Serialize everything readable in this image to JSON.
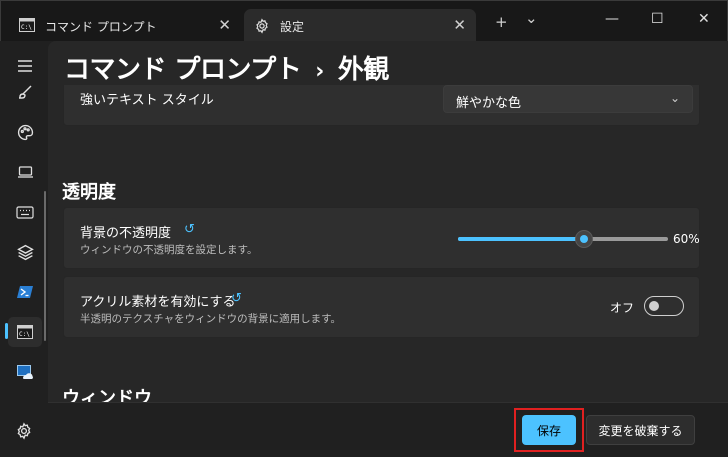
{
  "tabs": [
    {
      "label": "コマンド プロンプト",
      "icon": "cmd-icon",
      "close": "✕"
    },
    {
      "label": "設定",
      "icon": "gear-icon",
      "close": "✕"
    }
  ],
  "titlebar": {
    "new_tab": "+",
    "dropdown": "⌄",
    "minimize": "—",
    "maximize": "☐",
    "close": "✕"
  },
  "breadcrumb": {
    "parent": "コマンド プロンプト",
    "separator": "›",
    "current": "外観"
  },
  "text_style": {
    "label": "強いテキスト スタイル",
    "value": "鮮やかな色",
    "chevron": "⌄"
  },
  "transparency": {
    "section_title": "透明度",
    "opacity": {
      "title": "背景の不透明度",
      "description": "ウィンドウの不透明度を設定します。",
      "value_text": "60%",
      "value": 0.6
    },
    "acrylic": {
      "title": "アクリル素材を有効にする",
      "description": "半透明のテクスチャをウィンドウの背景に適用します。",
      "state_text": "オフ",
      "on": false
    }
  },
  "next_section": "ウィンドウ",
  "footer": {
    "save": "保存",
    "discard": "変更を破棄する"
  },
  "colors": {
    "accent": "#4cc2ff",
    "highlight": "#e02020",
    "bg": "#202020",
    "card": "#2f2f2f"
  }
}
